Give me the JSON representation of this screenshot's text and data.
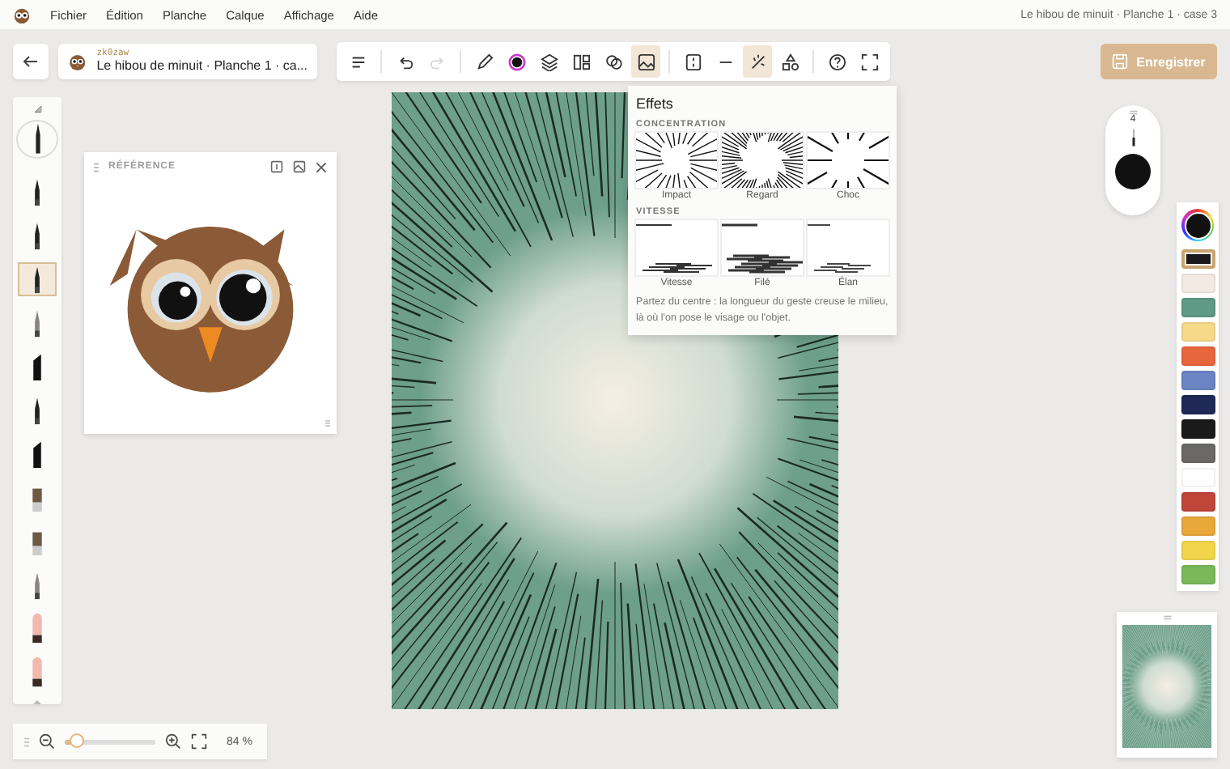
{
  "menu_bar": {
    "items": [
      "Fichier",
      "Édition",
      "Planche",
      "Calque",
      "Affichage",
      "Aide"
    ],
    "document_title": "Le hibou de minuit · Planche 1 · case 3"
  },
  "header": {
    "author": "zk0zaw",
    "title": "Le hibou de minuit · Planche 1 · ca..."
  },
  "toolbar": {
    "groups": [
      [
        {
          "kind": "menu",
          "selected": false,
          "disabled": false
        }
      ],
      [
        {
          "kind": "undo",
          "selected": false,
          "disabled": false
        },
        {
          "kind": "redo",
          "selected": false,
          "disabled": true
        }
      ],
      [
        {
          "kind": "pen",
          "selected": false,
          "disabled": false
        },
        {
          "kind": "color",
          "selected": false,
          "disabled": false
        },
        {
          "kind": "layers",
          "selected": false,
          "disabled": false
        },
        {
          "kind": "panels",
          "selected": false,
          "disabled": false
        },
        {
          "kind": "blend",
          "selected": false,
          "disabled": false
        },
        {
          "kind": "image",
          "selected": true,
          "disabled": false
        }
      ],
      [
        {
          "kind": "frame",
          "selected": false,
          "disabled": false
        },
        {
          "kind": "line",
          "selected": false,
          "disabled": false
        },
        {
          "kind": "wand",
          "selected": true,
          "disabled": false
        },
        {
          "kind": "shapes",
          "selected": false,
          "disabled": false
        }
      ],
      [
        {
          "kind": "help",
          "selected": false,
          "disabled": false
        },
        {
          "kind": "fullscreen",
          "selected": false,
          "disabled": false
        }
      ]
    ]
  },
  "save_button": {
    "label": "Enregistrer"
  },
  "brushes": [
    {
      "kind": "pencil",
      "selected": false
    },
    {
      "kind": "ink",
      "selected": false
    },
    {
      "kind": "fine",
      "selected": true
    },
    {
      "kind": "graphite",
      "selected": false
    },
    {
      "kind": "marker",
      "selected": false
    },
    {
      "kind": "ink",
      "selected": false
    },
    {
      "kind": "chisel",
      "selected": false
    },
    {
      "kind": "round",
      "selected": false
    },
    {
      "kind": "flat",
      "selected": false
    },
    {
      "kind": "airbrush",
      "selected": false
    },
    {
      "kind": "eraser",
      "selected": false
    },
    {
      "kind": "soft-eraser",
      "selected": false
    }
  ],
  "reference": {
    "title": "RÉFÉRENCE"
  },
  "effects": {
    "title": "Effets",
    "sections": [
      {
        "label": "CONCENTRATION",
        "items": [
          {
            "label": "Impact",
            "kind": "burst"
          },
          {
            "label": "Regard",
            "kind": "focus"
          },
          {
            "label": "Choc",
            "kind": "shock"
          }
        ]
      },
      {
        "label": "VITESSE",
        "items": [
          {
            "label": "Vitesse",
            "kind": "speed"
          },
          {
            "label": "Filé",
            "kind": "blur"
          },
          {
            "label": "Élan",
            "kind": "dash"
          }
        ]
      }
    ],
    "hint": "Partez du centre : la longueur du geste creuse le milieu, là où l'on pose le visage ou l'objet."
  },
  "brush_size": {
    "value": "4"
  },
  "palette": {
    "current": {
      "color": "#111111"
    },
    "swatches": [
      {
        "color": "#1a1a1a",
        "selected": true
      },
      {
        "color": "#f3ebe3",
        "selected": false
      },
      {
        "color": "#5e9a86",
        "selected": false
      },
      {
        "color": "#f7d98a",
        "selected": false
      },
      {
        "color": "#e8663c",
        "selected": false
      },
      {
        "color": "#6a84c4",
        "selected": false
      },
      {
        "color": "#1e2a55",
        "selected": false
      },
      {
        "color": "#1a1a1a",
        "selected": false
      },
      {
        "color": "#6b6967",
        "selected": false
      },
      {
        "color": "#ffffff",
        "selected": false
      },
      {
        "color": "#c0463a",
        "selected": false
      },
      {
        "color": "#e8a83a",
        "selected": false
      },
      {
        "color": "#f2d54a",
        "selected": false
      },
      {
        "color": "#7ab85a",
        "selected": false
      }
    ]
  },
  "zoom": {
    "level": 0.15,
    "value": "84 %"
  }
}
